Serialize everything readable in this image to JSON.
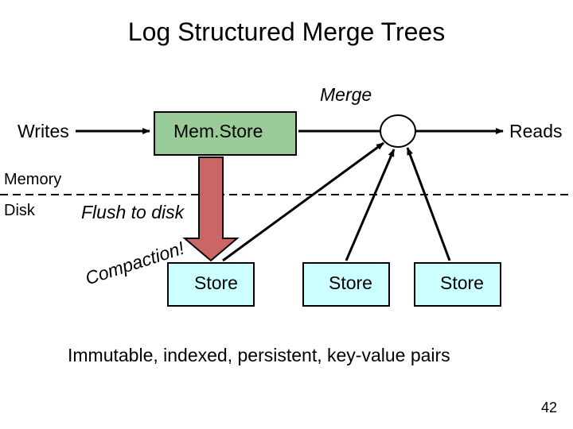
{
  "title": "Log Structured Merge Trees",
  "labels": {
    "writes": "Writes",
    "reads": "Reads",
    "merge": "Merge",
    "memory": "Memory",
    "disk": "Disk",
    "flush": "Flush to disk",
    "compaction": "Compaction!",
    "memstore": "Mem.Store"
  },
  "stores": [
    "Store",
    "Store",
    "Store"
  ],
  "subtitle": "Immutable, indexed, persistent, key-value pairs",
  "page_number": "42",
  "colors": {
    "memstore_fill": "#99cc99",
    "store_fill": "#ccffff",
    "divider": "#000000"
  }
}
